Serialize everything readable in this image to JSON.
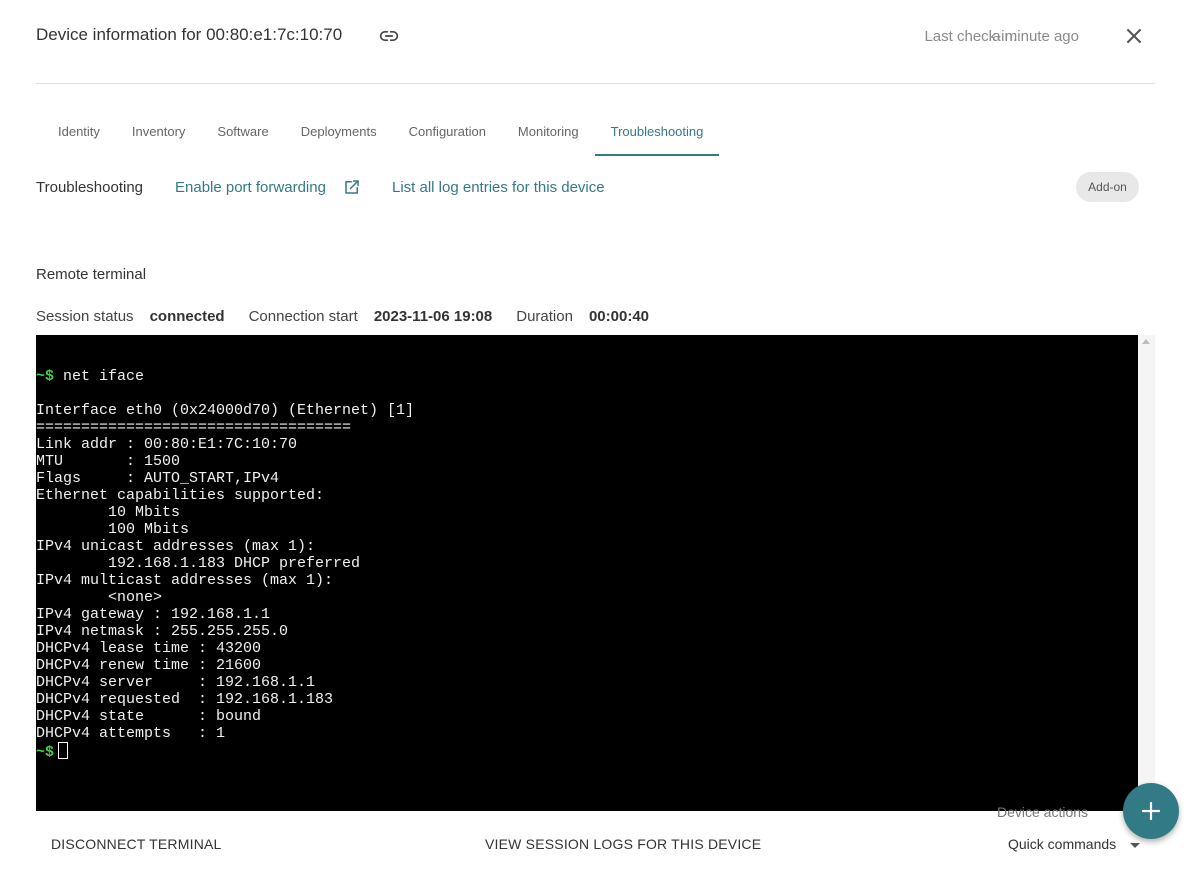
{
  "header": {
    "title": "Device information for 00:80:e1:7c:10:70",
    "last_checkin_label": "Last check-in:",
    "last_checkin_value": "a minute ago",
    "link_icon": "link-icon",
    "close_icon": "close-icon"
  },
  "tabs": [
    {
      "label": "Identity"
    },
    {
      "label": "Inventory"
    },
    {
      "label": "Software"
    },
    {
      "label": "Deployments"
    },
    {
      "label": "Configuration"
    },
    {
      "label": "Monitoring"
    },
    {
      "label": "Troubleshooting",
      "active": true
    }
  ],
  "troubleshooting": {
    "label": "Troubleshooting",
    "port_forwarding_link": "Enable port forwarding",
    "external_link_icon": "external-link-icon",
    "log_entries_link": "List all log entries for this device",
    "addon_badge": "Add-on"
  },
  "remote_terminal": {
    "title": "Remote terminal",
    "session_status_label": "Session status",
    "session_status_value": "connected",
    "connection_start_label": "Connection start",
    "connection_start_value": "2023-11-06 19:08",
    "duration_label": "Duration",
    "duration_value": "00:00:40"
  },
  "terminal": {
    "prompt": "~$",
    "command": " net iface",
    "output": "Interface eth0 (0x24000d70) (Ethernet) [1]\n===================================\nLink addr : 00:80:E1:7C:10:70\nMTU       : 1500\nFlags     : AUTO_START,IPv4\nEthernet capabilities supported:\n        10 Mbits\n        100 Mbits\nIPv4 unicast addresses (max 1):\n        192.168.1.183 DHCP preferred\nIPv4 multicast addresses (max 1):\n        <none>\nIPv4 gateway : 192.168.1.1\nIPv4 netmask : 255.255.255.0\nDHCPv4 lease time : 43200\nDHCPv4 renew time : 21600\nDHCPv4 server     : 192.168.1.1\nDHCPv4 requested  : 192.168.1.183\nDHCPv4 state      : bound\nDHCPv4 attempts   : 1",
    "prompt_color": "#3bd43b"
  },
  "footer": {
    "disconnect_button": "DISCONNECT TERMINAL",
    "session_logs_button": "VIEW SESSION LOGS FOR THIS DEVICE",
    "device_actions_label": "Device actions",
    "quick_commands_label": "Quick commands",
    "fab_icon": "plus-icon"
  },
  "colors": {
    "accent": "#337a87",
    "terminal_bg": "#000000",
    "terminal_fg": "#f0f0f0"
  }
}
